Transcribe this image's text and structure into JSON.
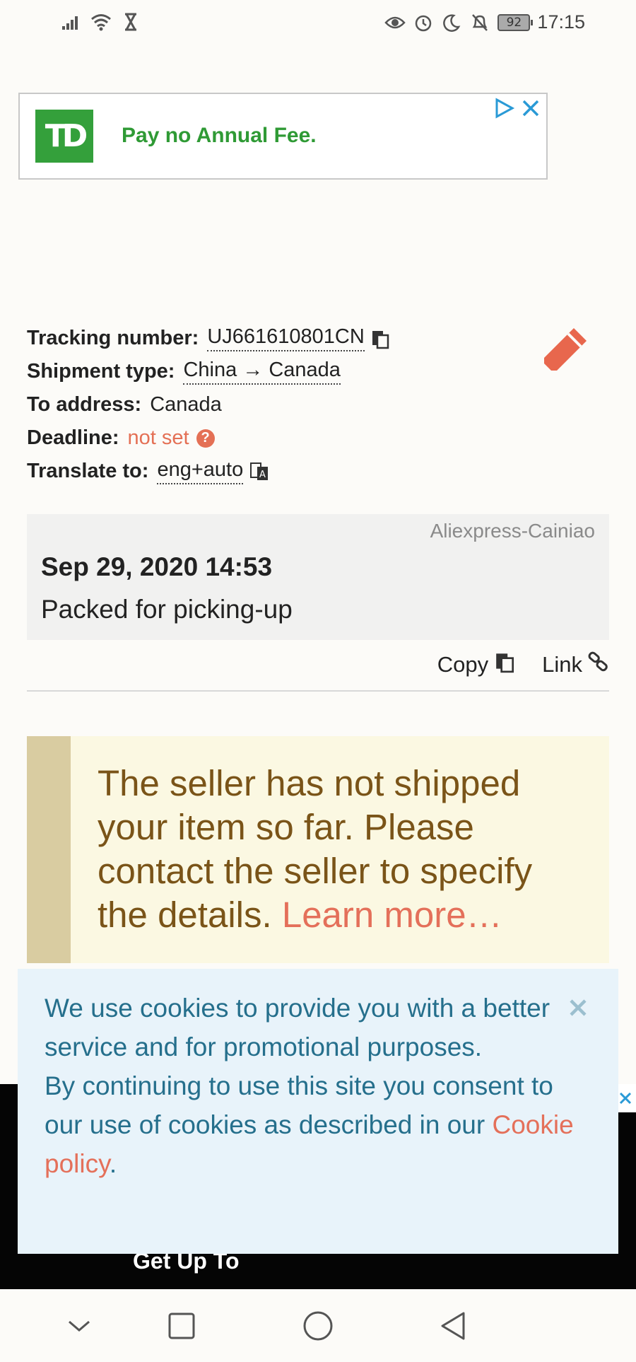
{
  "status_bar": {
    "battery": "92",
    "time": "17:15",
    "left_icons": [
      "signal-icon",
      "wifi-icon",
      "hourglass-icon"
    ],
    "right_icons": [
      "eye-icon",
      "alarm-icon",
      "moon-icon",
      "bell-off-icon"
    ]
  },
  "ad_banner": {
    "logo_text": "TD",
    "text": "Pay no Annual Fee.",
    "brand_color": "#34a03b"
  },
  "shipment": {
    "tracking_label": "Tracking number:",
    "tracking_value": "UJ661610801CN",
    "type_label": "Shipment type:",
    "type_value": "China → Canada",
    "address_label": "To address:",
    "address_value": "Canada",
    "deadline_label": "Deadline:",
    "deadline_value": "not set",
    "deadline_help": "?",
    "translate_label": "Translate to:",
    "translate_value": "eng+auto"
  },
  "event": {
    "carrier": "Aliexpress-Cainiao",
    "date": "Sep 29, 2020 14:53",
    "description": "Packed for picking-up"
  },
  "actions": {
    "copy": "Copy",
    "link": "Link"
  },
  "warning": {
    "text": "The seller has not shipped your item so far. Please contact the seller to specify the details. ",
    "link": "Learn more…"
  },
  "bottom_ad": {
    "text": "Get Up To"
  },
  "cookie": {
    "line1": "We use cookies to provide you with a better service and for promotional purposes.",
    "line2": "By continuing to use this site you consent to our use of cookies as described in our ",
    "link": "Cookie policy",
    "suffix": "."
  },
  "colors": {
    "accent": "#e47055",
    "warning_text": "#7a5418",
    "cookie_text": "#256f8c"
  }
}
